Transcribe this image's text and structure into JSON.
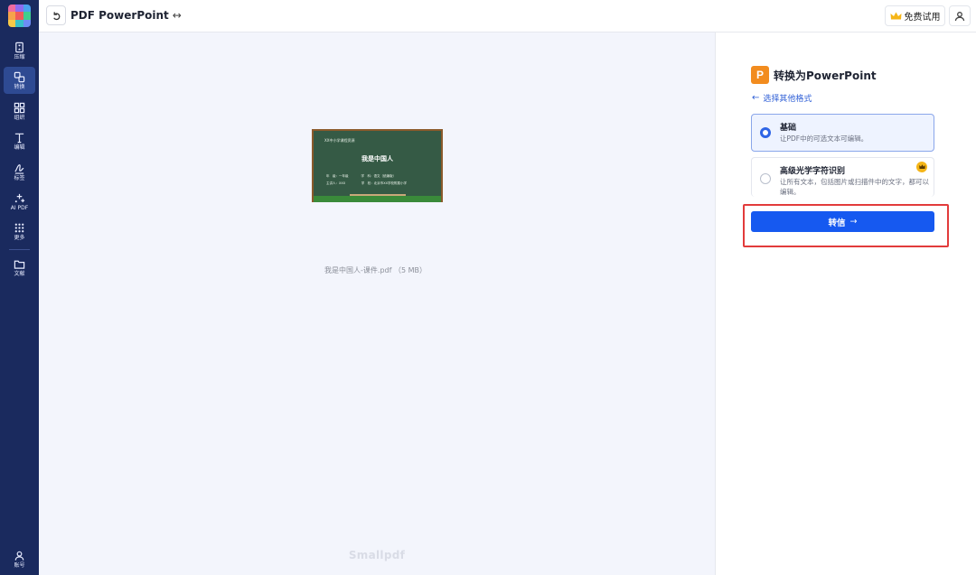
{
  "app": {
    "title": "PDF PowerPoint",
    "title_swap_icon": "↔",
    "trial_label": "免费试用",
    "watermark": "Smallpdf"
  },
  "sidebar": {
    "items": [
      {
        "label": "压缩",
        "icon": "compress-icon"
      },
      {
        "label": "转换",
        "icon": "convert-icon",
        "active": true
      },
      {
        "label": "组织",
        "icon": "organize-icon"
      },
      {
        "label": "编辑",
        "icon": "edit-icon"
      },
      {
        "label": "标签",
        "icon": "sign-icon"
      },
      {
        "label": "AI PDF",
        "icon": "ai-icon"
      },
      {
        "label": "更多",
        "icon": "more-icon"
      },
      {
        "label": "文献",
        "icon": "folder-icon"
      }
    ],
    "account_label": "账号"
  },
  "preview": {
    "file_name": "我是中国人-课件.pdf （5 MB）",
    "slide": {
      "header": "XX中小学课程资源",
      "title": "我是中国人",
      "line1": "年　级：一年级　　　　学　科：语文（统编版）",
      "line2": "主讲人：XXX　　　　　学　校：北京市XX学校附属小学"
    }
  },
  "panel": {
    "badge": "P",
    "title": "转换为PowerPoint",
    "other_formats_link": "选择其他格式",
    "options": [
      {
        "title": "基础",
        "desc": "让PDF中的可选文本可编辑。",
        "selected": true
      },
      {
        "title": "高级光学字符识别",
        "desc": "让所有文本，包括图片或扫描件中的文字，都可以编辑。",
        "premium": true
      }
    ],
    "convert_label": "转信",
    "convert_arrow": "→"
  },
  "colors": {
    "sidebar_bg": "#1a2a5e",
    "accent": "#1659f0",
    "ppt_orange": "#f28c1f",
    "highlight_red": "#e23b3b"
  }
}
